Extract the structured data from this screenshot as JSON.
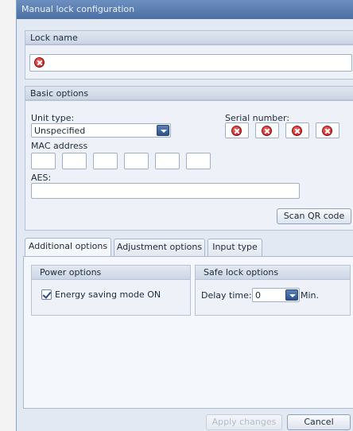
{
  "window": {
    "title": "Manual lock configuration"
  },
  "lock_name": {
    "header": "Lock name",
    "value": ""
  },
  "basic_options": {
    "header": "Basic options",
    "unit_type_label": "Unit type:",
    "unit_type_value": "Unspecified",
    "serial_label": "Serial number:",
    "mac_label": "MAC address",
    "aes_label": "AES:",
    "aes_value": "",
    "scan_button": "Scan QR code"
  },
  "tabs": [
    {
      "label": "Additional options",
      "active": true
    },
    {
      "label": "Adjustment options",
      "active": false
    },
    {
      "label": "Input type",
      "active": false
    }
  ],
  "power_options": {
    "header": "Power options",
    "energy_saving_label": "Energy saving mode ON",
    "energy_saving_checked": true
  },
  "safe_lock_options": {
    "header": "Safe lock options",
    "delay_label": "Delay time:",
    "delay_value": "0",
    "delay_unit": "Min."
  },
  "footer": {
    "apply_button": "Apply changes",
    "cancel_button": "Cancel"
  },
  "colors": {
    "titlebar": "#4c6fa4",
    "error_icon": "#c01818",
    "accent": "#2e528c"
  }
}
